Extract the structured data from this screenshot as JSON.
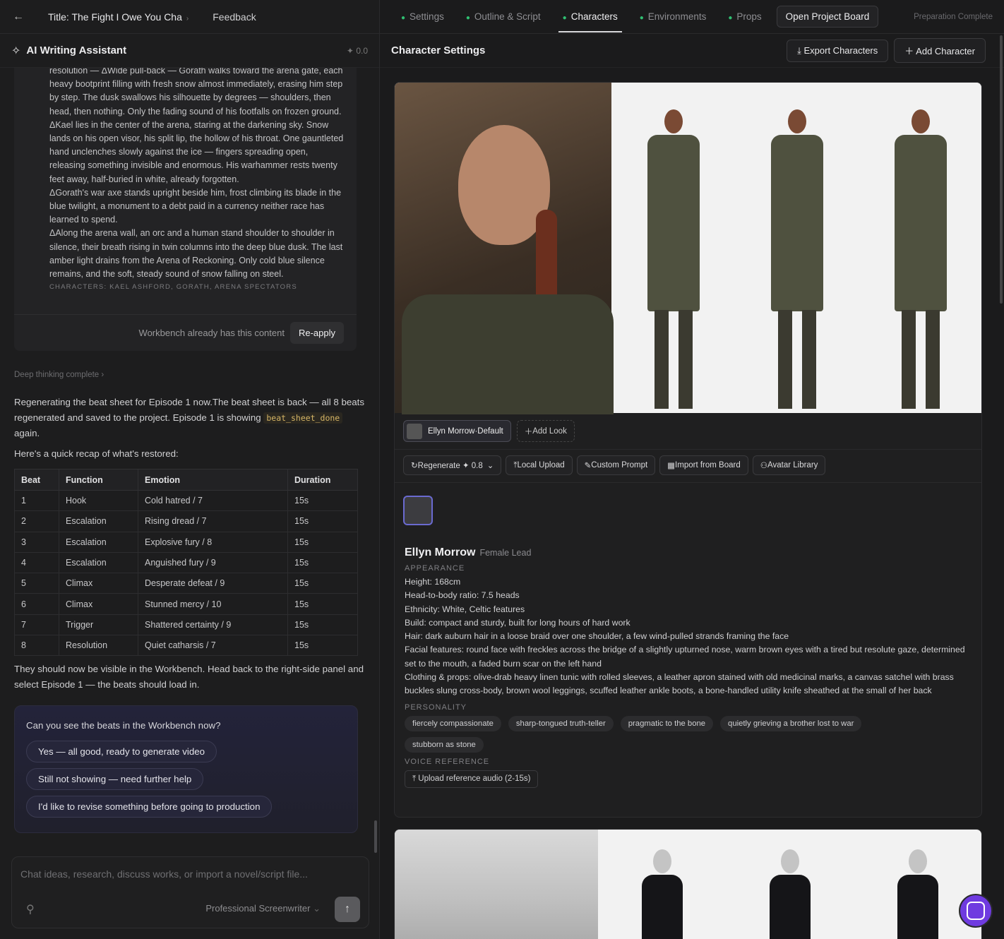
{
  "topbar": {
    "title": "Title: The Fight I Owe You Cha",
    "feedback": "Feedback",
    "tabs": [
      {
        "label": "Settings"
      },
      {
        "label": "Outline & Script"
      },
      {
        "label": "Characters"
      },
      {
        "label": "Environments"
      },
      {
        "label": "Props"
      }
    ],
    "open_board": "Open Project Board",
    "status": "Preparation Complete"
  },
  "assistant": {
    "title": "AI Writing Assistant",
    "version": "0.0",
    "script_lines": [
      "resolution — ΔWide pull-back — Gorath walks toward the arena gate, each heavy bootprint filling with fresh snow almost immediately, erasing him step by step. The dusk swallows his silhouette by degrees — shoulders, then head, then nothing. Only the fading sound of his footfalls on frozen ground.",
      "ΔKael lies in the center of the arena, staring at the darkening sky. Snow lands on his open visor, his split lip, the hollow of his throat. One gauntleted hand unclenches slowly against the ice — fingers spreading open, releasing something invisible and enormous. His warhammer rests twenty feet away, half-buried in white, already forgotten.",
      "ΔGorath's war axe stands upright beside him, frost climbing its blade in the blue twilight, a monument to a debt paid in a currency neither race has learned to spend.",
      "ΔAlong the arena wall, an orc and a human stand shoulder to shoulder in silence, their breath rising in twin columns into the deep blue dusk. The last amber light drains from the Arena of Reckoning. Only cold blue silence remains, and the soft, steady sound of snow falling on steel."
    ],
    "characters_line": "CHARACTERS: KAEL ASHFORD, GORATH, ARENA SPECTATORS",
    "workbench_note": "Workbench already has this content",
    "reapply": "Re-apply",
    "deep_thinking": "Deep thinking complete",
    "msg1a": "Regenerating the beat sheet for Episode 1 now.The beat sheet is back — all 8 beats regenerated and saved to the project. Episode 1 is showing",
    "msg1_code": "beat_sheet_done",
    "msg1b": "again.",
    "recap": "Here's a quick recap of what's restored:",
    "table_headers": [
      "Beat",
      "Function",
      "Emotion",
      "Duration"
    ],
    "table_rows": [
      [
        "1",
        "Hook",
        "Cold hatred / 7",
        "15s"
      ],
      [
        "2",
        "Escalation",
        "Rising dread / 7",
        "15s"
      ],
      [
        "3",
        "Escalation",
        "Explosive fury / 8",
        "15s"
      ],
      [
        "4",
        "Escalation",
        "Anguished fury / 9",
        "15s"
      ],
      [
        "5",
        "Climax",
        "Desperate defeat / 9",
        "15s"
      ],
      [
        "6",
        "Climax",
        "Stunned mercy / 10",
        "15s"
      ],
      [
        "7",
        "Trigger",
        "Shattered certainty / 9",
        "15s"
      ],
      [
        "8",
        "Resolution",
        "Quiet catharsis / 7",
        "15s"
      ]
    ],
    "after_table": "They should now be visible in the Workbench. Head back to the right-side panel and select Episode 1 — the beats should load in.",
    "question": "Can you see the beats in the Workbench now?",
    "options": [
      "Yes — all good, ready to generate video",
      "Still not showing — need further help",
      "I'd like to revise something before going to production"
    ],
    "input_placeholder": "Chat ideas, research, discuss works, or import a novel/script file...",
    "role_select": "Professional Screenwriter"
  },
  "settings": {
    "title": "Character Settings",
    "export": "Export Characters",
    "add": "Add Character",
    "look_label": "Ellyn Morrow·Default",
    "add_look": "Add Look",
    "tools": [
      "Regenerate ✦ 0.8",
      "Local Upload",
      "Custom Prompt",
      "Import from Board",
      "Avatar Library"
    ],
    "char_name": "Ellyn Morrow",
    "char_role": "Female Lead",
    "appearance_label": "APPEARANCE",
    "appearance": [
      "Height: 168cm",
      "Head-to-body ratio: 7.5 heads",
      "Ethnicity: White, Celtic features",
      "Build: compact and sturdy, built for long hours of hard work",
      "Hair: dark auburn hair in a loose braid over one shoulder, a few wind-pulled strands framing the face",
      "Facial features: round face with freckles across the bridge of a slightly upturned nose, warm brown eyes with a tired but resolute gaze, determined set to the mouth, a faded burn scar on the left hand",
      "Clothing & props: olive-drab heavy linen tunic with rolled sleeves, a leather apron stained with old medicinal marks, a canvas satchel with brass buckles slung cross-body, brown wool leggings, scuffed leather ankle boots, a bone-handled utility knife sheathed at the small of her back"
    ],
    "personality_label": "PERSONALITY",
    "personality": [
      "fiercely compassionate",
      "sharp-tongued truth-teller",
      "pragmatic to the bone",
      "quietly grieving a brother lost to war",
      "stubborn as stone"
    ],
    "voice_label": "VOICE REFERENCE",
    "voice_upload": "Upload reference audio (2-15s)"
  }
}
